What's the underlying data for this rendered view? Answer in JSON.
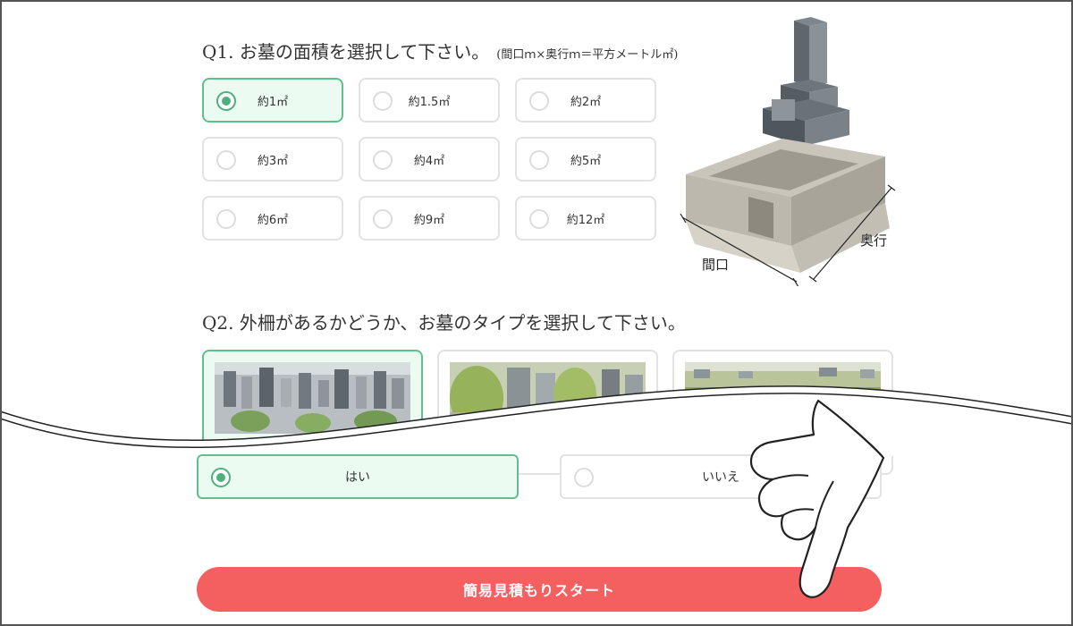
{
  "q1": {
    "title": "Q1. お墓の面積を選択して下さい。",
    "subtitle": "(間口ｍ×奥行ｍ＝平方メートル㎡)",
    "options": [
      {
        "label": "約1㎡",
        "selected": true
      },
      {
        "label": "約1.5㎡",
        "selected": false
      },
      {
        "label": "約2㎡",
        "selected": false
      },
      {
        "label": "約3㎡",
        "selected": false
      },
      {
        "label": "約4㎡",
        "selected": false
      },
      {
        "label": "約5㎡",
        "selected": false
      },
      {
        "label": "約6㎡",
        "selected": false
      },
      {
        "label": "約9㎡",
        "selected": false
      },
      {
        "label": "約12㎡",
        "selected": false
      }
    ]
  },
  "diagram": {
    "label_width": "間口",
    "label_depth": "奥行"
  },
  "q2": {
    "title": "Q2. 外柵があるかどうか、お墓のタイプを選択して下さい。",
    "yes_label": "はい",
    "no_label": "いいえ"
  },
  "start_label": "簡易見積もりスタート",
  "colors": {
    "accent_green": "#4db17d",
    "selected_bg": "#ebfbf2",
    "cta_red": "#f46060"
  }
}
